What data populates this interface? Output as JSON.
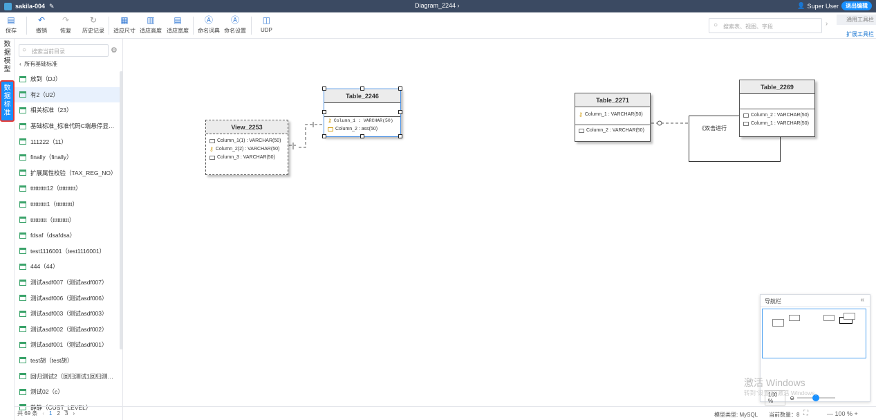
{
  "topbar": {
    "project": "sakila-004",
    "title": "Diagram_2244 ›",
    "user": "Super User",
    "exit": "退出编辑"
  },
  "toolbar": {
    "save": "保存",
    "undo": "撤销",
    "redo": "恢复",
    "history": "历史记录",
    "fit_size": "适应尺寸",
    "fit_height": "适应高度",
    "fit_width": "适应宽度",
    "naming_dict": "命名词典",
    "naming_settings": "命名设置",
    "udp": "UDP",
    "search_placeholder": "搜索表、视图、字段",
    "tab_common": "通用工具栏",
    "tab_ext": "扩展工具栏"
  },
  "vtabs": {
    "model": "数\n据\n模\n型",
    "standard": "数\n据\n标\n准"
  },
  "panel": {
    "search_placeholder": "搜索当前目录",
    "crumb": "所有基础标准",
    "items": [
      "放到（DJ）",
      "有2（U2）",
      "相关标准（23）",
      "基础标准_标准代码C端悬停显…",
      "111222（11）",
      "finally（finally）",
      "扩展属性校验（TAX_REG_NO）",
      "tttttttttt12（tttttttttt）",
      "tttttttttt1（tttttttttt）",
      "tttttttttt（tttttttttt）",
      "fdsaf（dsafdsa）",
      "test1116001（test1116001）",
      "444（44）",
      "测试asdf007（测试asdf007）",
      "测试asdf006（测试asdf006）",
      "测试asdf003（测试asdf003）",
      "测试asdf002（测试asdf002）",
      "测试asdf001（测试asdf001）",
      "test胡（test胡）",
      "回归测试2（回归测试1回归测…",
      "测试02（c）",
      "静静（CUST_LEVEL）"
    ],
    "total": "共 69 条",
    "pages": [
      "1",
      "2",
      "3"
    ]
  },
  "canvas": {
    "view_2253": {
      "name": "View_2253",
      "cols": [
        "Column_1(1) : VARCHAR(50)",
        "Column_2(2) : VARCHAR(50)",
        "Column_3 : VARCHAR(50)"
      ]
    },
    "table_2246": {
      "name": "Table_2246",
      "cols": [
        "Column_1 : VARCHAR(50)",
        "Column_2 : ass(50)"
      ]
    },
    "table_2271": {
      "name": "Table_2271",
      "cols": [
        "Column_1 : VARCHAR(50)",
        "Column_2 : VARCHAR(50)"
      ]
    },
    "table_2269": {
      "name": "Table_2269",
      "cols": [
        "Column_2 : VARCHAR(50)",
        "Column_1 : VARCHAR(50)"
      ]
    },
    "note": "《双击进行"
  },
  "navigator": {
    "title": "导航栏",
    "zoom": "100 %"
  },
  "watermark": {
    "line1": "激活 Windows",
    "line2": "转到\"设置\"以激活 Windows。"
  },
  "status": {
    "model_type": "模型类型: MySQL",
    "count": "当前数量：8",
    "zoom": "—   100 %   +"
  },
  "colors": {
    "topbar": "#3b4a62",
    "accent": "#1890ff",
    "highlight": "#e53935"
  }
}
